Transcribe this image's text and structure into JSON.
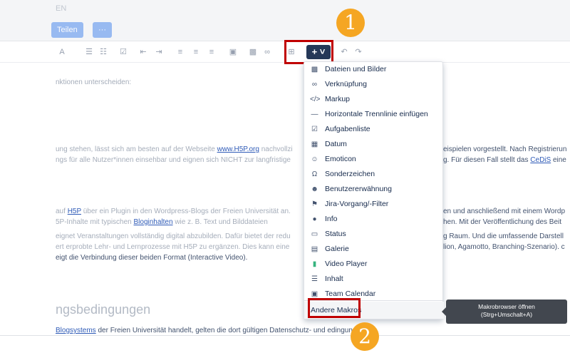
{
  "header": {
    "faded_title": "EN"
  },
  "buttons": {
    "edit_label": "Teilen",
    "more_label": "···"
  },
  "toolbar": {
    "plus_label": "+ ˅",
    "icons": [
      "text-color-icon",
      "bullet-list-icon",
      "numbered-list-icon",
      "checkbox-icon",
      "outdent-icon",
      "indent-icon",
      "align-left-icon",
      "align-center-icon",
      "align-right-icon",
      "layout-icon",
      "image-icon",
      "link-icon",
      "table-icon",
      "undo-icon",
      "redo-icon"
    ]
  },
  "content": {
    "line1": "nktionen unterscheiden:",
    "line2a": "ung stehen, lässt sich am besten auf der Webseite ",
    "line2_link": "www.H5P.org",
    "line2b": " nachvollzi",
    "line2c": "eispielen vorgestellt. Nach Registrierun",
    "line3a": "ngs für alle Nutzer*innen einsehbar und eignen sich NICHT zur langfristige",
    "line3b": "g. Für diesen Fall stellt das ",
    "line3_link": "CeDiS",
    "line3c": " eine",
    "line4a": "auf ",
    "line4_link": "H5P",
    "line4b": " über ein Plugin in den Wordpress-Blogs der Freien Universität an.",
    "line4c": "en und anschließend mit einem Wordp",
    "line5a": "5P-Inhalte mit typischen ",
    "line5_link": "Bloginhalten",
    "line5b": " wie z. B. Text und Bilddateien",
    "line5c": "hen. Mit der Veröffentlichung des Beit",
    "line6a": "eignet Veranstaltungen vollständig digital abzubilden. Dafür bietet der redu",
    "line6b": "g Raum. Und die umfassende Darstell",
    "line7a": "ert erprobte Lehr- und Lernprozesse mit H5P zu ergänzen. Dies kann eine",
    "line7b": "lion, Agamotto, Branching-Szenario). c",
    "line8": "eigt die Verbindung dieser beiden Format (Interactive Video).",
    "heading": "ngsbedingungen",
    "footer_a": "Blogsystems",
    "footer_b": " der Freien Universität handelt, gelten die dort gültigen Datenschutz- und ",
    "footer_c": "edingungen."
  },
  "menu": {
    "items": [
      {
        "icon": "image-icon",
        "label": "Dateien und Bilder"
      },
      {
        "icon": "link-icon",
        "label": "Verknüpfung"
      },
      {
        "icon": "code-icon",
        "label": "Markup"
      },
      {
        "icon": "horizontal-rule-icon",
        "label": "Horizontale Trennlinie einfügen"
      },
      {
        "icon": "checkbox-icon",
        "label": "Aufgabenliste"
      },
      {
        "icon": "calendar-icon",
        "label": "Datum"
      },
      {
        "icon": "emoticon-icon",
        "label": "Emoticon"
      },
      {
        "icon": "omega-icon",
        "label": "Sonderzeichen"
      },
      {
        "icon": "mention-icon",
        "label": "Benutzererwähnung"
      },
      {
        "icon": "jira-icon",
        "label": "Jira-Vorgang/-Filter"
      },
      {
        "icon": "info-icon",
        "label": "Info"
      },
      {
        "icon": "status-icon",
        "label": "Status"
      },
      {
        "icon": "gallery-icon",
        "label": "Galerie"
      },
      {
        "icon": "video-icon",
        "label": "Video Player"
      },
      {
        "icon": "toc-icon",
        "label": "Inhalt"
      },
      {
        "icon": "team-calendar-icon",
        "label": "Team Calendar"
      }
    ],
    "other_label": "Andere Makros"
  },
  "tooltip": {
    "line1": "Makrobrowser öffnen",
    "line2": "(Strg+Umschalt+A)"
  },
  "badges": {
    "one": "1",
    "two": "2"
  },
  "colors": {
    "accent_red": "#c00000",
    "badge_orange": "#f5a623",
    "plus_button": "#253858"
  }
}
